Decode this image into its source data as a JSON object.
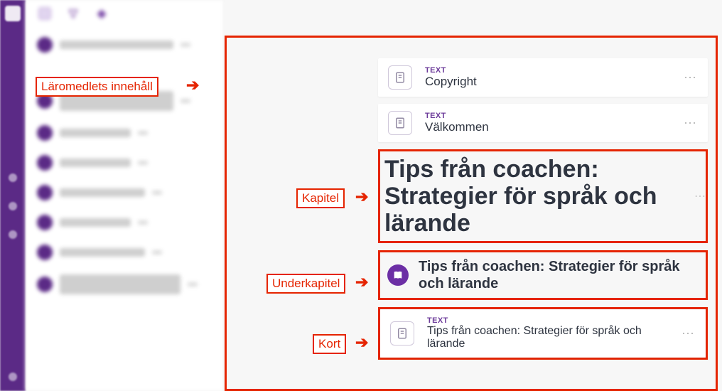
{
  "annotations": {
    "laromedel": "Läromedlets innehåll",
    "kapitel": "Kapitel",
    "underkapitel": "Underkapitel",
    "kort": "Kort"
  },
  "cards": {
    "type_label": "TEXT",
    "copyright": "Copyright",
    "welcome": "Välkommen",
    "bottom_card": "Tips från coachen: Strategier för språk och lärande"
  },
  "chapter_title": "Tips från coachen: Strategier för språk och lärande",
  "subchapter_title": "Tips från coachen: Strategier för språk och lärande"
}
